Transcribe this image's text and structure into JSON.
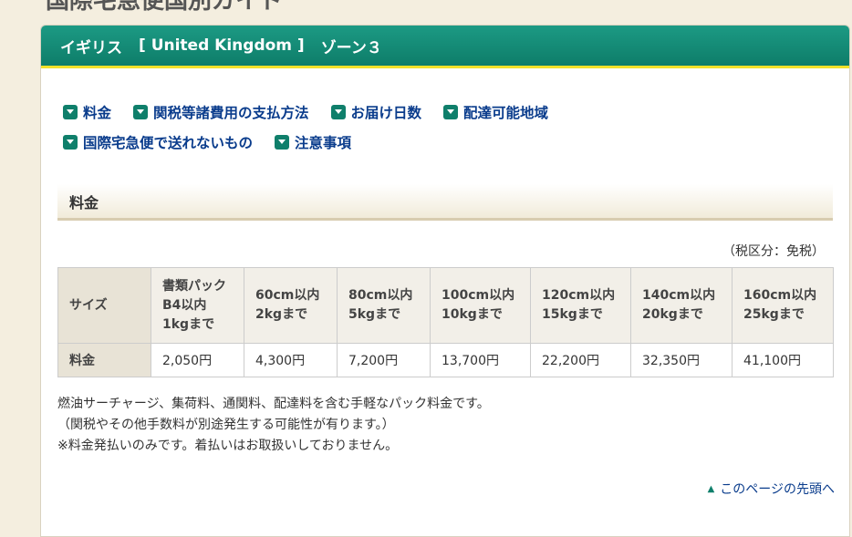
{
  "page_heading": "国際宅急便国別ガイド",
  "country": {
    "name": "イギリス",
    "english": "[ United Kingdom ]",
    "zone": "ゾーン３"
  },
  "nav_links": [
    [
      "料金",
      "関税等諸費用の支払方法",
      "お届け日数",
      "配達可能地域"
    ],
    [
      "国際宅急便で送れないもの",
      "注意事項"
    ]
  ],
  "section": {
    "title": "料金"
  },
  "tax_note": "（税区分：免税）",
  "price_table": {
    "row_headers": [
      "サイズ",
      "料金"
    ],
    "sizes": [
      [
        "書類パック",
        "B4以内",
        "1kgまで"
      ],
      [
        "60cm以内",
        "2kgまで"
      ],
      [
        "80cm以内",
        "5kgまで"
      ],
      [
        "100cm以内",
        "10kgまで"
      ],
      [
        "120cm以内",
        "15kgまで"
      ],
      [
        "140cm以内",
        "20kgまで"
      ],
      [
        "160cm以内",
        "25kgまで"
      ]
    ],
    "prices": [
      "2,050円",
      "4,300円",
      "7,200円",
      "13,700円",
      "22,200円",
      "32,350円",
      "41,100円"
    ]
  },
  "notes": [
    "燃油サーチャージ、集荷料、通関料、配達料を含む手軽なパック料金です。",
    "（関税やその他手数料が別途発生する可能性が有ります。）",
    "※料金発払いのみです。着払いはお取扱いしておりません。"
  ],
  "back_to_top": "このページの先頭へ",
  "icons": {
    "nav": "chevron-down-icon",
    "back_to_top": "arrow-up-icon"
  },
  "colors": {
    "header": "#0e7d69",
    "accent_bar": "#f2e12a",
    "link": "#0a3c8c"
  }
}
